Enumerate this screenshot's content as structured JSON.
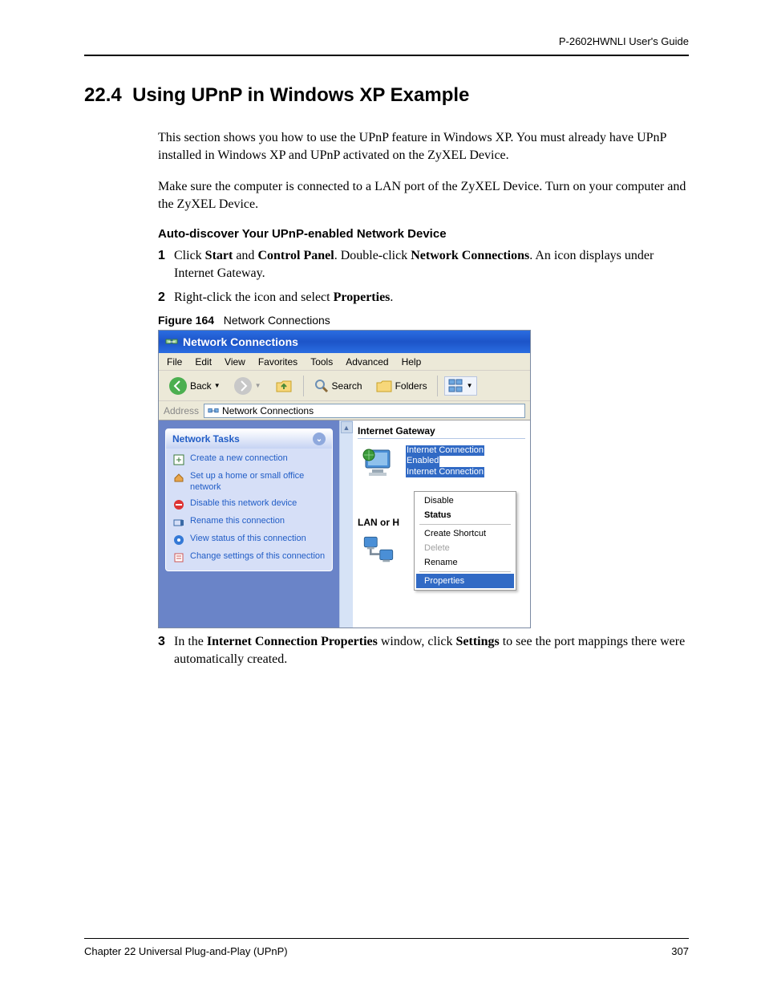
{
  "header": {
    "guide": "P-2602HWNLI User's Guide"
  },
  "footer": {
    "chapter": "Chapter 22 Universal Plug-and-Play (UPnP)",
    "page": "307"
  },
  "section": {
    "number": "22.4",
    "title": "Using UPnP in Windows XP Example",
    "p1": "This section shows you how to use the UPnP feature in Windows XP. You must already have UPnP installed in Windows XP and UPnP activated on the ZyXEL Device.",
    "p2": "Make sure the computer is connected to a LAN port of the ZyXEL Device. Turn on your computer and the ZyXEL Device.",
    "h3": "Auto-discover Your UPnP-enabled Network Device",
    "steps": {
      "1": {
        "pre": "Click ",
        "b1": "Start",
        "mid1": " and ",
        "b2": "Control Panel",
        "mid2": ". Double-click ",
        "b3": "Network Connections",
        "post": ". An icon displays under Internet Gateway."
      },
      "2": {
        "pre": "Right-click the icon and select ",
        "b1": "Properties",
        "post": "."
      },
      "3": {
        "pre": "In the ",
        "b1": "Internet Connection Properties",
        "mid1": " window, click ",
        "b2": "Settings",
        "post": " to see the port mappings there were automatically created."
      }
    },
    "figcap": {
      "label": "Figure 164",
      "title": "Network Connections"
    }
  },
  "xp": {
    "title": "Network Connections",
    "menus": [
      "File",
      "Edit",
      "View",
      "Favorites",
      "Tools",
      "Advanced",
      "Help"
    ],
    "toolbar": {
      "back": "Back",
      "search": "Search",
      "folders": "Folders"
    },
    "address": {
      "label": "Address",
      "value": "Network Connections"
    },
    "tasks": {
      "title": "Network Tasks",
      "items": [
        "Create a new connection",
        "Set up a home or small office network",
        "Disable this network device",
        "Rename this connection",
        "View status of this connection",
        "Change settings of this connection"
      ]
    },
    "right": {
      "group1": "Internet Gateway",
      "conn": {
        "l1": "Internet Connection",
        "l2": "Enabled",
        "l3": "Internet Connection"
      },
      "lan": "LAN or H"
    },
    "context": {
      "disable": "Disable",
      "status": "Status",
      "create": "Create Shortcut",
      "delete": "Delete",
      "rename": "Rename",
      "properties": "Properties"
    }
  }
}
